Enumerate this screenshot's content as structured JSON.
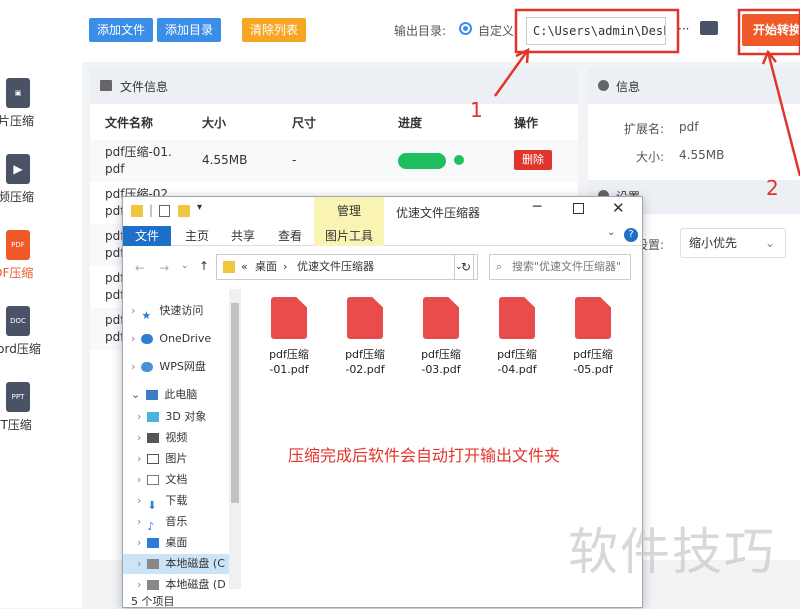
{
  "sidebar": {
    "items": [
      {
        "label": "图片压缩",
        "icon": "image-file-icon",
        "color": "#5a6478"
      },
      {
        "label": "视频压缩",
        "icon": "video-file-icon",
        "color": "#5a6478"
      },
      {
        "label": "PDF压缩",
        "icon": "pdf-file-icon",
        "icon_text": "PDF",
        "color": "#f05a28",
        "active": true
      },
      {
        "label": "Word压缩",
        "icon": "doc-file-icon",
        "icon_text": "DOC",
        "color": "#5a6478"
      },
      {
        "label": "PPT压缩",
        "icon": "ppt-file-icon",
        "icon_text": "PPT",
        "color": "#5a6478"
      }
    ]
  },
  "toolbar": {
    "add_file": "添加文件",
    "add_dir": "添加目录",
    "clear_list": "清除列表",
    "output_label": "输出目录:",
    "custom_label": "自定义",
    "output_path": "C:\\Users\\admin\\Deskto",
    "more": "···",
    "start": "开始转换"
  },
  "file_panel": {
    "title": "文件信息",
    "columns": [
      "文件名称",
      "大小",
      "尺寸",
      "进度",
      "操作"
    ],
    "rows": [
      {
        "name1": "pdf压缩-01.",
        "name2": "pdf",
        "size": "4.55MB",
        "dim": "-",
        "delete": "删除"
      },
      {
        "name1": "pdf压缩-02.",
        "name2": "pdf"
      },
      {
        "name1": "pdf",
        "name2": "pdf"
      },
      {
        "name1": "pdf",
        "name2": "pdf"
      },
      {
        "name1": "pdf",
        "name2": "pdf"
      }
    ]
  },
  "info_panel": {
    "title": "信息",
    "ext_label": "扩展名:",
    "ext_value": "pdf",
    "size_label": "大小:",
    "size_value": "4.55MB",
    "settings_title": "设置",
    "setting_label": "设置:",
    "setting_value": "缩小优先"
  },
  "explorer": {
    "title": "优速文件压缩器",
    "manage_tab": "管理",
    "tabs": [
      "文件",
      "主页",
      "共享",
      "查看",
      "图片工具"
    ],
    "path_root": "«",
    "path_1": "桌面",
    "path_2": "优速文件压缩器",
    "search_placeholder": "搜索\"优速文件压缩器\"",
    "tree": [
      "快速访问",
      "OneDrive",
      "WPS网盘",
      "此电脑",
      "3D 对象",
      "视频",
      "图片",
      "文档",
      "下载",
      "音乐",
      "桌面",
      "本地磁盘 (C",
      "本地磁盘 (D"
    ],
    "files": [
      "pdf压缩",
      "pdf压缩",
      "pdf压缩",
      "pdf压缩",
      "pdf压缩"
    ],
    "files_line2": [
      "-01.pdf",
      "-02.pdf",
      "-03.pdf",
      "-04.pdf",
      "-05.pdf"
    ],
    "status": "5 个项目"
  },
  "annotations": {
    "caption": "压缩完成后软件会自动打开输出文件夹",
    "num1": "1",
    "num2": "2",
    "watermark": "软件技巧"
  }
}
